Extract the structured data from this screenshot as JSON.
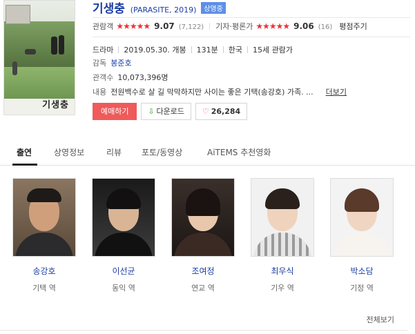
{
  "poster": {
    "title": "기생충"
  },
  "movie": {
    "title": "기생충",
    "subtitle": "(PARASITE, 2019)",
    "status_badge": "상영중"
  },
  "ratings": {
    "audience_label": "관람객",
    "audience_stars": "★★★★★",
    "audience_score": "9.07",
    "audience_count": "(7,122)",
    "critic_label": "기자·평론가",
    "critic_stars": "★★★★★",
    "critic_score": "9.06",
    "critic_count": "(16)",
    "write_review": "평점주기"
  },
  "meta": {
    "genre": "드라마",
    "release": "2019.05.30. 개봉",
    "runtime": "131분",
    "country": "한국",
    "rating": "15세 관람가"
  },
  "director": {
    "label": "감독",
    "name": "봉준호"
  },
  "audience": {
    "label": "관객수",
    "value": "10,073,396명"
  },
  "synopsis": {
    "label": "내용",
    "text": "전원백수로 살 길 막막하지만 사이는 좋은 기택(송강호) 가족. ...",
    "more": "더보기"
  },
  "buttons": {
    "buy": "예매하기",
    "download": "다운로드",
    "like_count": "26,284"
  },
  "tabs": [
    {
      "label": "출연",
      "active": true
    },
    {
      "label": "상영정보",
      "active": false
    },
    {
      "label": "리뷰",
      "active": false
    },
    {
      "label": "포토/동영상",
      "active": false
    },
    {
      "label": "AiTEMS 추천영화",
      "active": false
    }
  ],
  "cast": [
    {
      "name": "송강호",
      "role": "기택 역"
    },
    {
      "name": "이선균",
      "role": "동익 역"
    },
    {
      "name": "조여정",
      "role": "연교 역"
    },
    {
      "name": "최우식",
      "role": "기우 역"
    },
    {
      "name": "박소담",
      "role": "기정 역"
    }
  ],
  "view_all": "전체보기",
  "colors": {
    "title_blue": "#1b3da3",
    "badge_blue": "#5e8fe6",
    "star_red": "#e8353b",
    "buy_red": "#ef5a5a"
  }
}
